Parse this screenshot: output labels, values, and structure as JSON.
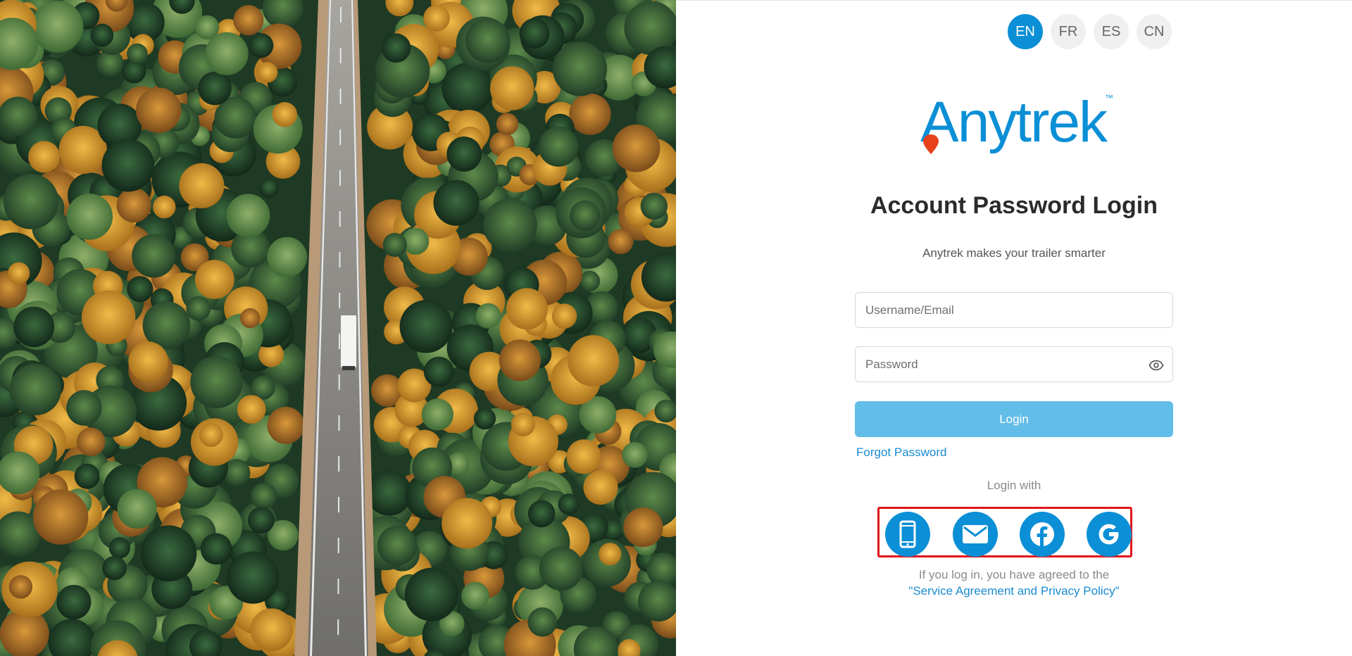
{
  "languages": [
    {
      "code": "EN",
      "active": true
    },
    {
      "code": "FR",
      "active": false
    },
    {
      "code": "ES",
      "active": false
    },
    {
      "code": "CN",
      "active": false
    }
  ],
  "brand": {
    "logo_text": "Anytrek",
    "trademark": "™",
    "primary_color": "#0b8fd6",
    "pin_color": "#e8401c"
  },
  "login": {
    "title": "Account Password Login",
    "subtitle": "Anytrek makes your trailer smarter",
    "username_placeholder": "Username/Email",
    "password_placeholder": "Password",
    "submit_label": "Login",
    "forgot_label": "Forgot Password",
    "login_with_label": "Login with",
    "agreement_text": "If you log in, you have agreed to the",
    "policy_link": "\"Service Agreement and Privacy Policy\""
  },
  "social_logins": [
    {
      "icon": "phone-icon"
    },
    {
      "icon": "mail-icon"
    },
    {
      "icon": "facebook-icon"
    },
    {
      "icon": "google-icon"
    }
  ]
}
